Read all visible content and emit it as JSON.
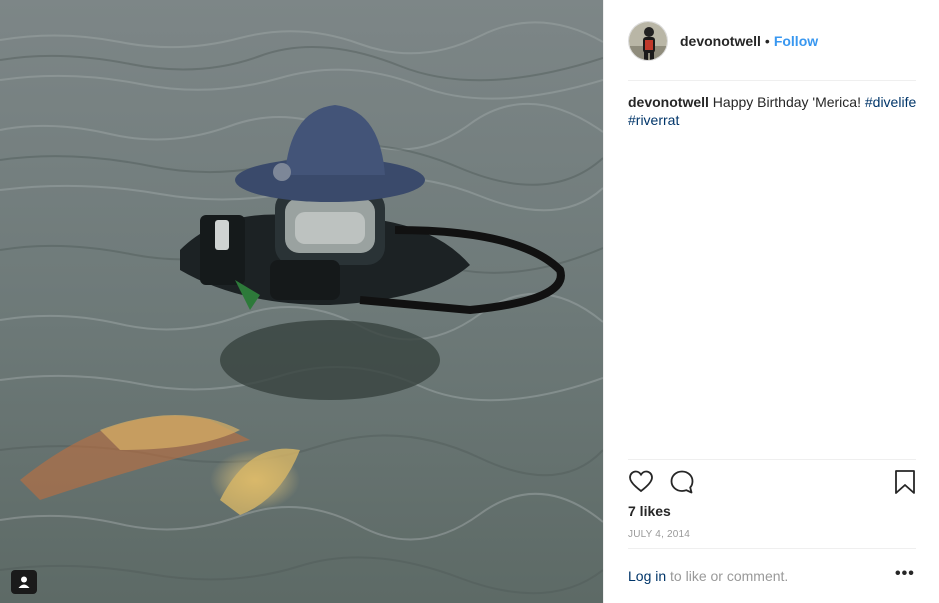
{
  "post": {
    "username": "devonotwell",
    "separator": "•",
    "follow_label": "Follow",
    "caption_username": "devonotwell",
    "caption_text": "Happy Birthday 'Merica!",
    "hashtags": [
      "#divelife",
      "#riverrat"
    ],
    "likes": "7 likes",
    "date": "JULY 4, 2014",
    "login_link": "Log in",
    "login_suffix": " to like or comment.",
    "more_label": "•••"
  },
  "icons": {
    "like": "heart-icon",
    "comment": "comment-bubble-icon",
    "save": "bookmark-icon",
    "tag": "user-tag-icon"
  },
  "colors": {
    "follow": "#3897f0",
    "hashtag": "#003569",
    "muted": "#999999",
    "text": "#262626"
  }
}
